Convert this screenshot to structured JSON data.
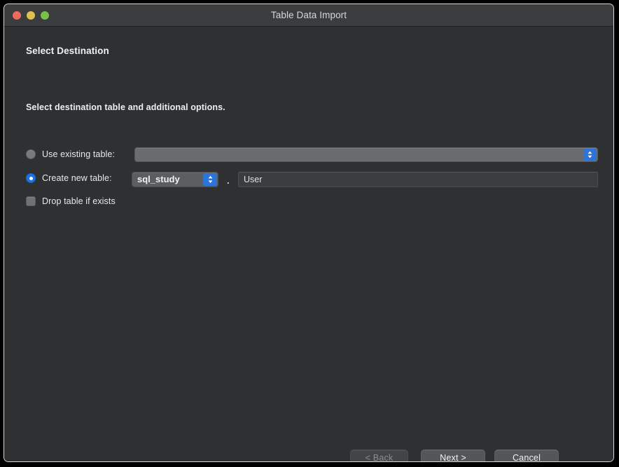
{
  "window": {
    "title": "Table Data Import",
    "traffic_lights": [
      {
        "name": "close-button",
        "color": "#ec6a5f"
      },
      {
        "name": "minimize-button",
        "color": "#e0c04d"
      },
      {
        "name": "maximize-button",
        "color": "#76c04b"
      }
    ]
  },
  "page": {
    "title": "Select Destination",
    "section_label": "Select destination table and additional options."
  },
  "form": {
    "existing_table": {
      "radio_label": "Use existing table:",
      "selected": false,
      "combo_value": "",
      "combo_placeholder": ""
    },
    "create_table": {
      "radio_label": "Create new table:",
      "selected": true,
      "schema_value": "sql_study",
      "separator": ".",
      "table_name_value": "User",
      "table_name_placeholder": ""
    },
    "drop_table": {
      "checkbox_label": "Drop table if exists",
      "checked": false
    }
  },
  "footer": {
    "back_label": "< Back",
    "next_label": "Next >",
    "cancel_label": "Cancel"
  },
  "colors": {
    "window_bg": "#2e3032",
    "titlebar_bg": "#3a3c3e",
    "accent_blue": "#1a73e8",
    "popup_arrow_blue": "#2d74da",
    "text_primary": "#f0f0f1",
    "text_disabled": "#8b8d8f"
  }
}
